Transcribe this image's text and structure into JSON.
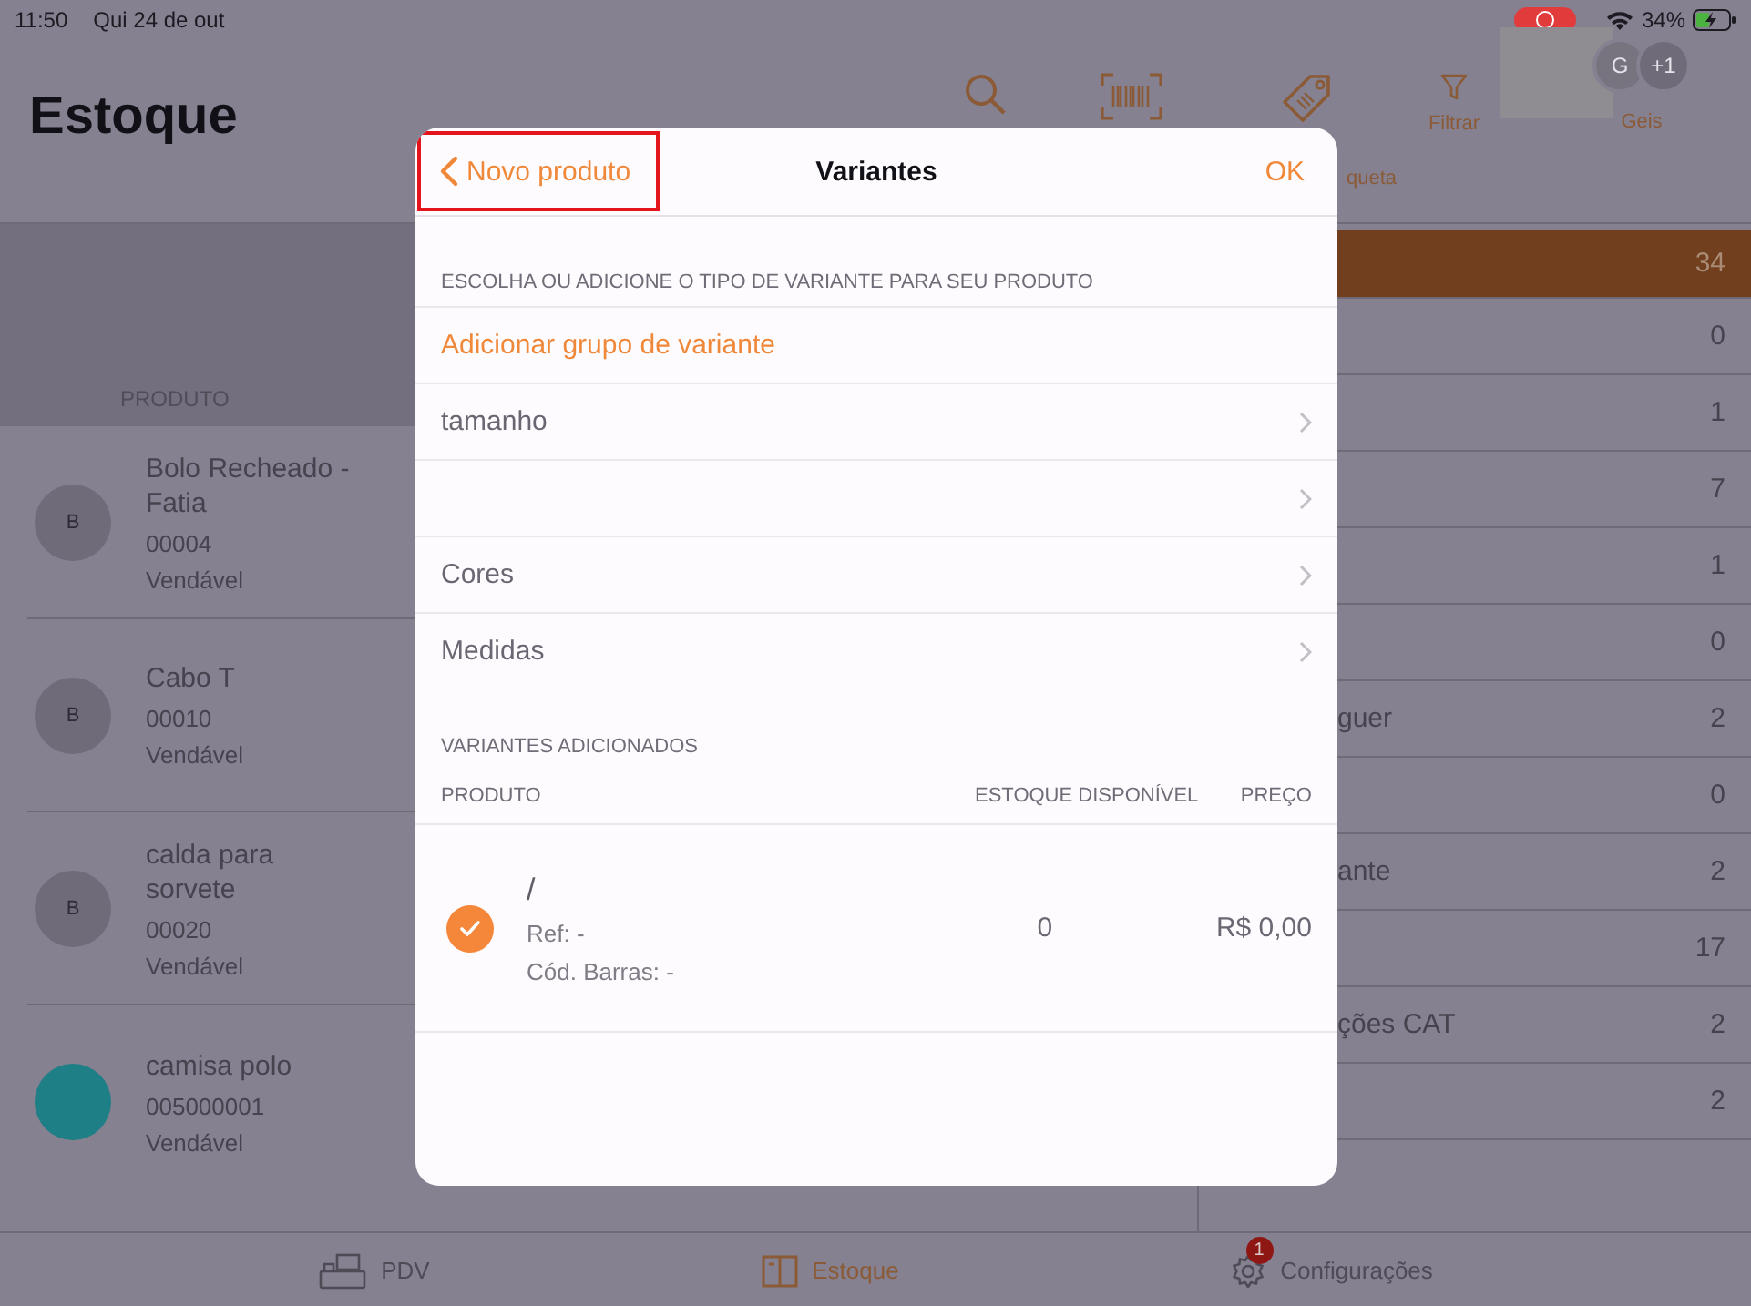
{
  "status_bar": {
    "time": "11:50",
    "date": "Qui 24 de out",
    "battery": "34%",
    "recording": true
  },
  "header": {
    "title": "Estoque",
    "tools": [
      {
        "kind": "search"
      },
      {
        "kind": "barcode"
      },
      {
        "kind": "tag",
        "label": "queta"
      },
      {
        "kind": "filter",
        "label": "Filtrar"
      }
    ],
    "user": {
      "initial": "G",
      "extra": "+1",
      "name": "Geis"
    }
  },
  "product_list": {
    "column": "PRODUTO",
    "items": [
      {
        "name": "Bolo Recheado - Fatia",
        "code": "00004",
        "status": "Vendável",
        "avatar": {
          "kind": "letter",
          "letter": "B"
        }
      },
      {
        "name": "Cabo T",
        "code": "00010",
        "status": "Vendável",
        "avatar": {
          "kind": "letter",
          "letter": "B"
        }
      },
      {
        "name": "calda para sorvete",
        "code": "00020",
        "status": "Vendável",
        "avatar": {
          "kind": "letter",
          "letter": "B"
        }
      },
      {
        "name": "camisa polo",
        "code": "005000001",
        "status": "Vendável",
        "avatar": {
          "kind": "photo"
        }
      }
    ]
  },
  "categories": [
    {
      "count": "34",
      "selected": true
    },
    {
      "count": "0",
      "selected": false
    },
    {
      "count": "1",
      "selected": false
    },
    {
      "count": "7",
      "selected": false
    },
    {
      "count": "1",
      "selected": false
    },
    {
      "count": "0",
      "selected": false
    },
    {
      "label": "guer",
      "count": "2",
      "selected": false
    },
    {
      "count": "0",
      "selected": false
    },
    {
      "label": "ante",
      "count": "2",
      "selected": false
    },
    {
      "count": "17",
      "selected": false
    },
    {
      "label": "ções CAT",
      "count": "2",
      "selected": false
    },
    {
      "count": "2",
      "selected": false
    }
  ],
  "modal": {
    "back_button": {
      "label": "Novo produto",
      "highlighted": true
    },
    "title": "Variantes",
    "done": "OK",
    "choose_section": "ESCOLHA OU ADICIONE O TIPO DE VARIANTE PARA SEU PRODUTO",
    "add_group": "Adicionar grupo de variante",
    "groups": [
      {
        "kind": "labeled",
        "label": "tamanho"
      },
      {
        "kind": "blank"
      },
      {
        "kind": "labeled",
        "label": "Cores"
      },
      {
        "kind": "labeled",
        "label": "Medidas"
      }
    ],
    "added_section": "VARIANTES ADICIONADOS",
    "columns": [
      "PRODUTO",
      "ESTOQUE DISPONÍVEL",
      "PREÇO"
    ],
    "variants": [
      {
        "name": "/",
        "ref": "Ref: -",
        "barcode": "Cód. Barras: -",
        "stock": "0",
        "price": "R$ 0,00",
        "checked": true
      }
    ]
  },
  "tab_bar": [
    {
      "label": "PDV",
      "selected": false
    },
    {
      "label": "Estoque",
      "selected": true
    },
    {
      "label": "Configurações",
      "selected": false,
      "badge": "1"
    }
  ]
}
